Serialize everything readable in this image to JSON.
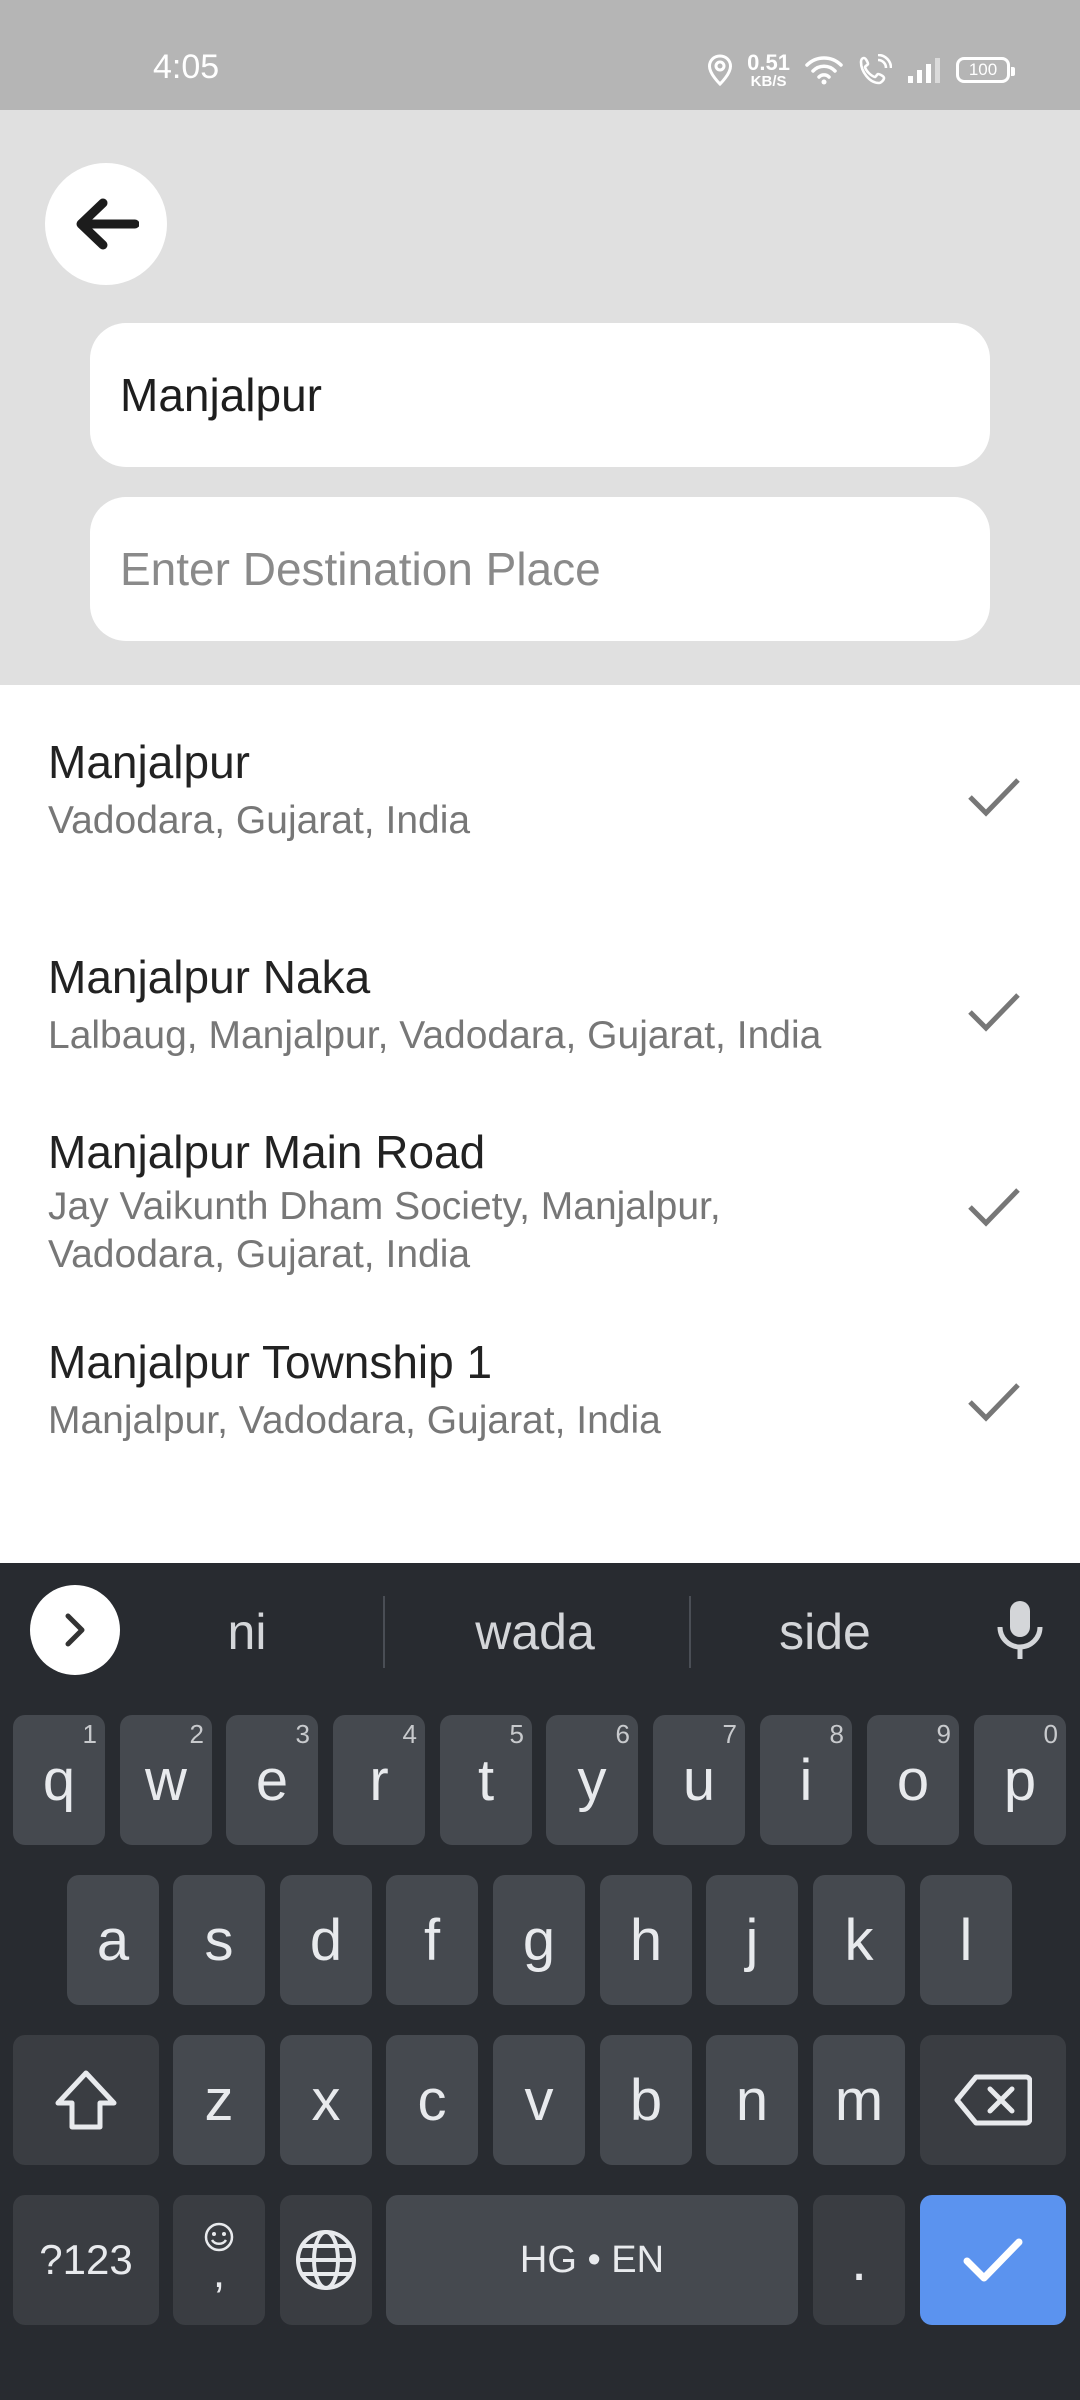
{
  "status": {
    "time": "4:05",
    "speed_value": "0.51",
    "speed_unit": "KB/S",
    "battery": "100"
  },
  "search": {
    "source_value": "Manjalpur",
    "destination_placeholder": "Enter Destination Place"
  },
  "results": [
    {
      "title": "Manjalpur",
      "subtitle": "Vadodara, Gujarat, India"
    },
    {
      "title": "Manjalpur Naka",
      "subtitle": "Lalbaug, Manjalpur, Vadodara, Gujarat, India"
    },
    {
      "title": "Manjalpur Main Road",
      "subtitle": "Jay Vaikunth Dham Society, Manjalpur, Vadodara, Gujarat, India"
    },
    {
      "title": "Manjalpur Township 1",
      "subtitle": "Manjalpur, Vadodara, Gujarat, India"
    }
  ],
  "keyboard": {
    "suggestions": [
      "ni",
      "wada",
      "side"
    ],
    "row1": [
      {
        "k": "q",
        "h": "1"
      },
      {
        "k": "w",
        "h": "2"
      },
      {
        "k": "e",
        "h": "3"
      },
      {
        "k": "r",
        "h": "4"
      },
      {
        "k": "t",
        "h": "5"
      },
      {
        "k": "y",
        "h": "6"
      },
      {
        "k": "u",
        "h": "7"
      },
      {
        "k": "i",
        "h": "8"
      },
      {
        "k": "o",
        "h": "9"
      },
      {
        "k": "p",
        "h": "0"
      }
    ],
    "row2": [
      "a",
      "s",
      "d",
      "f",
      "g",
      "h",
      "j",
      "k",
      "l"
    ],
    "row3": [
      "z",
      "x",
      "c",
      "v",
      "b",
      "n",
      "m"
    ],
    "symbols_label": "?123",
    "comma_label": ",",
    "space_label": "HG • EN",
    "period_label": "."
  },
  "colors": {
    "status_bar": "#b5b5b5",
    "header_bg": "#e0e0e0",
    "keyboard_bg": "#282b30",
    "enter_key": "#5b93ef"
  }
}
